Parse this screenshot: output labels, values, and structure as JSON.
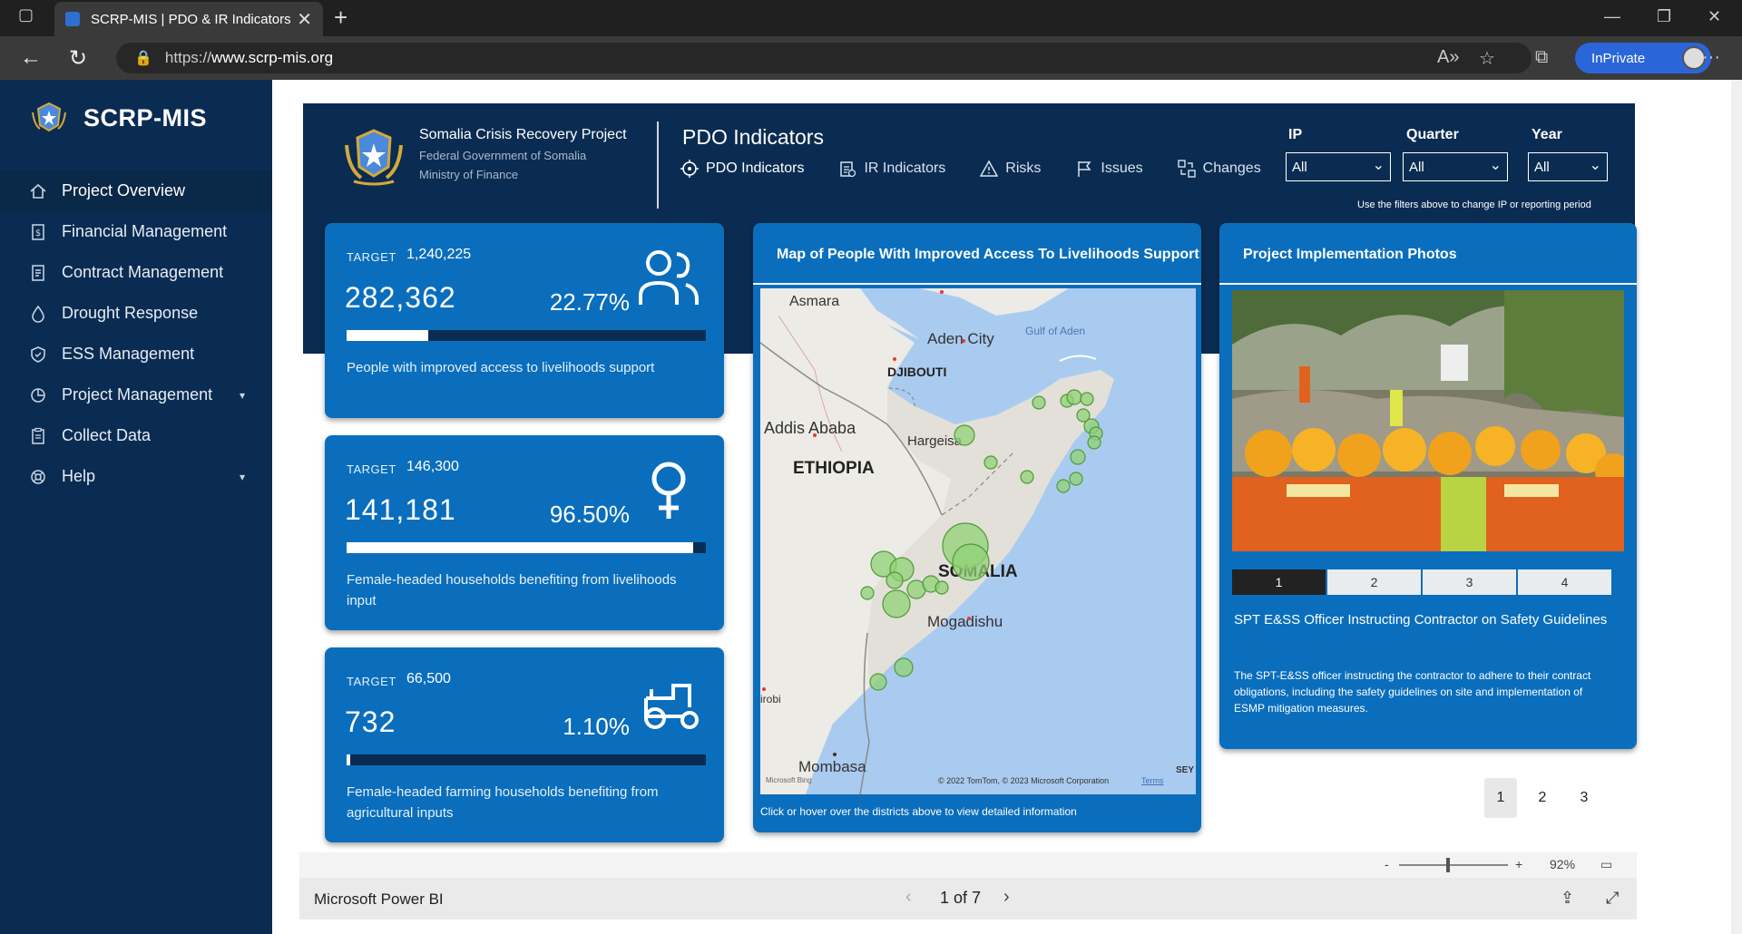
{
  "browser": {
    "tab_title": "SCRP-MIS | PDO & IR Indicators",
    "url_scheme": "https://",
    "url_host": "www.scrp-mis.org",
    "inprivate_label": "InPrivate"
  },
  "sidebar": {
    "brand": "SCRP-MIS",
    "items": [
      {
        "label": "Project Overview",
        "icon": "home-icon"
      },
      {
        "label": "Financial Management",
        "icon": "dollar-doc-icon"
      },
      {
        "label": "Contract Management",
        "icon": "contract-icon"
      },
      {
        "label": "Drought Response",
        "icon": "drop-icon"
      },
      {
        "label": "ESS Management",
        "icon": "shield-check-icon"
      },
      {
        "label": "Project Management",
        "icon": "pie-chart-icon"
      },
      {
        "label": "Collect Data",
        "icon": "clipboard-icon"
      },
      {
        "label": "Help",
        "icon": "lifebuoy-icon"
      }
    ]
  },
  "report": {
    "org": {
      "line1": "Somalia Crisis Recovery Project",
      "line2": "Federal Government of Somalia",
      "line3": "Ministry of Finance"
    },
    "page_title": "PDO Indicators",
    "tabs": [
      "PDO Indicators",
      "IR Indicators",
      "Risks",
      "Issues",
      "Changes"
    ],
    "filters": [
      {
        "label": "IP",
        "value": "All"
      },
      {
        "label": "Quarter",
        "value": "All"
      },
      {
        "label": "Year",
        "value": "All"
      }
    ],
    "filter_hint": "Use the filters above to change IP or reporting period",
    "kpis": [
      {
        "target_label": "TARGET",
        "target": "1,240,225",
        "value": "282,362",
        "percent": "22.77%",
        "progress": 0.2277,
        "desc": "People with improved access to livelihoods support"
      },
      {
        "target_label": "TARGET",
        "target": "146,300",
        "value": "141,181",
        "percent": "96.50%",
        "progress": 0.965,
        "desc": "Female-headed households benefiting from livelihoods input"
      },
      {
        "target_label": "TARGET",
        "target": "66,500",
        "value": "732",
        "percent": "1.10%",
        "progress": 0.011,
        "desc": "Female-headed farming households benefiting from agricultural inputs"
      }
    ],
    "map": {
      "title": "Map of People With Improved Access To Livelihoods Support",
      "footer": "Click or hover over the districts above to view detailed information",
      "labels": {
        "asmara": "Asmara",
        "aden": "Aden City",
        "gulf": "Gulf of Aden",
        "djibouti": "DJIBOUTI",
        "addis": "Addis Ababa",
        "hargeisa": "Hargeisa",
        "ethiopia": "ETHIOPIA",
        "somalia": "SOMALIA",
        "mogadishu": "Mogadishu",
        "nairobi": "irobi",
        "mombasa": "Mombasa",
        "sey": "SEY"
      },
      "copyright": "© 2022 TomTom, © 2023 Microsoft Corporation",
      "terms": "Terms",
      "bing": "Microsoft Bing"
    },
    "photos": {
      "title": "Project Implementation Photos",
      "pages": [
        "1",
        "2",
        "3",
        "4"
      ],
      "selected_page": "1",
      "caption_title": "SPT E&SS Officer Instructing Contractor on Safety Guidelines",
      "caption_text": "The SPT-E&SS officer instructing the contractor to adhere to their contract obligations, including the safety guidelines on site and implementation of ESMP mitigation measures."
    },
    "page_numbers": [
      "1",
      "2",
      "3"
    ],
    "selected_page_number": "1"
  },
  "powerbi": {
    "brand": "Microsoft Power BI",
    "page_indicator": "1 of 7",
    "zoom": "92%",
    "zoom_minus": "-",
    "zoom_plus": "+"
  }
}
